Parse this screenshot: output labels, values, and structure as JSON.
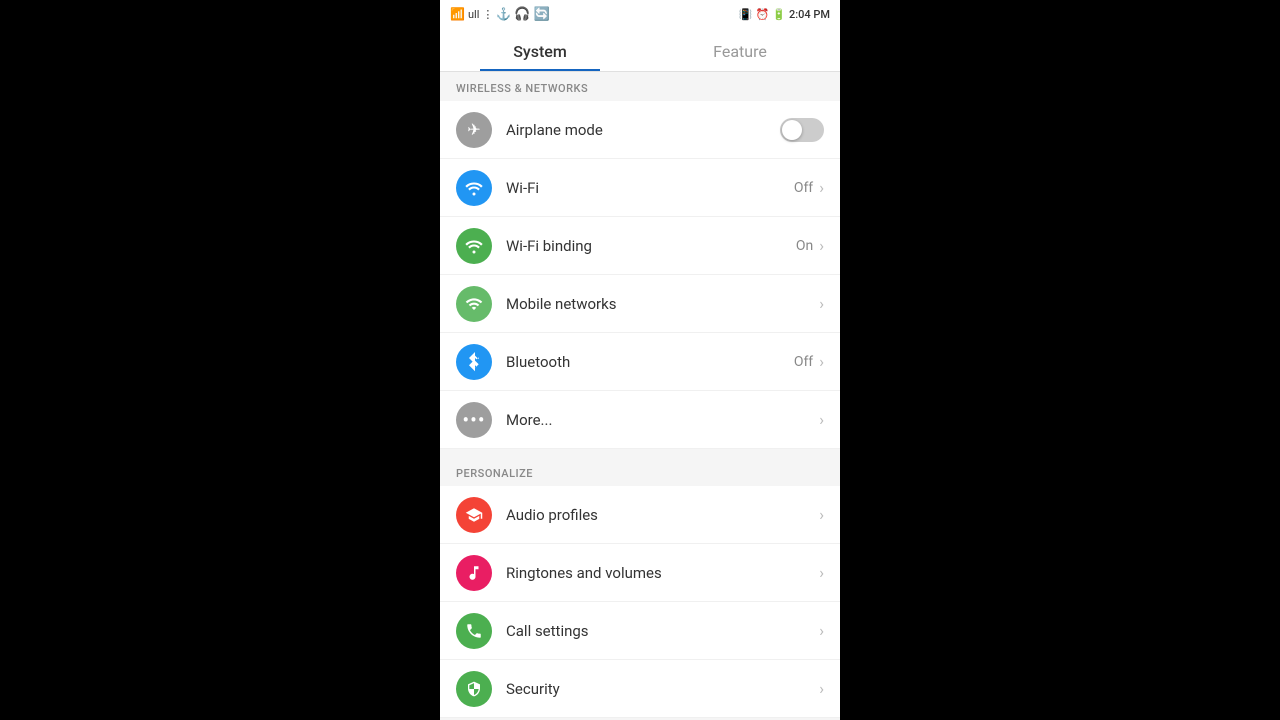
{
  "statusBar": {
    "time": "2:04 PM",
    "signalIcon": "📶",
    "batteryIcon": "🔋"
  },
  "tabs": [
    {
      "id": "system",
      "label": "System",
      "active": true
    },
    {
      "id": "feature",
      "label": "Feature",
      "active": false
    }
  ],
  "sections": [
    {
      "id": "wireless",
      "header": "WIRELESS & NETWORKS",
      "items": [
        {
          "id": "airplane-mode",
          "label": "Airplane mode",
          "iconBg": "#9e9e9e",
          "iconSymbol": "✈",
          "hasToggle": true,
          "toggleOn": false,
          "value": "",
          "hasChevron": false
        },
        {
          "id": "wifi",
          "label": "Wi-Fi",
          "iconBg": "#2196f3",
          "iconSymbol": "wifi",
          "hasToggle": false,
          "value": "Off",
          "hasChevron": true
        },
        {
          "id": "wifi-binding",
          "label": "Wi-Fi binding",
          "iconBg": "#4caf50",
          "iconSymbol": "wifi2",
          "hasToggle": false,
          "value": "On",
          "hasChevron": true
        },
        {
          "id": "mobile-networks",
          "label": "Mobile networks",
          "iconBg": "#66bb6a",
          "iconSymbol": "signal",
          "hasToggle": false,
          "value": "",
          "hasChevron": true
        },
        {
          "id": "bluetooth",
          "label": "Bluetooth",
          "iconBg": "#2196f3",
          "iconSymbol": "bt",
          "hasToggle": false,
          "value": "Off",
          "hasChevron": true
        },
        {
          "id": "more",
          "label": "More...",
          "iconBg": "#9e9e9e",
          "iconSymbol": "⋯",
          "hasToggle": false,
          "value": "",
          "hasChevron": true
        }
      ]
    },
    {
      "id": "personalize",
      "header": "PERSONALIZE",
      "items": [
        {
          "id": "audio-profiles",
          "label": "Audio profiles",
          "iconBg": "#f44336",
          "iconSymbol": "bell",
          "hasToggle": false,
          "value": "",
          "hasChevron": true
        },
        {
          "id": "ringtones",
          "label": "Ringtones and volumes",
          "iconBg": "#e91e63",
          "iconSymbol": "music",
          "hasToggle": false,
          "value": "",
          "hasChevron": true
        },
        {
          "id": "call-settings",
          "label": "Call settings",
          "iconBg": "#4caf50",
          "iconSymbol": "phone",
          "hasToggle": false,
          "value": "",
          "hasChevron": true
        },
        {
          "id": "security",
          "label": "Security",
          "iconBg": "#4caf50",
          "iconSymbol": "lock",
          "hasToggle": false,
          "value": "",
          "hasChevron": true
        }
      ]
    }
  ]
}
